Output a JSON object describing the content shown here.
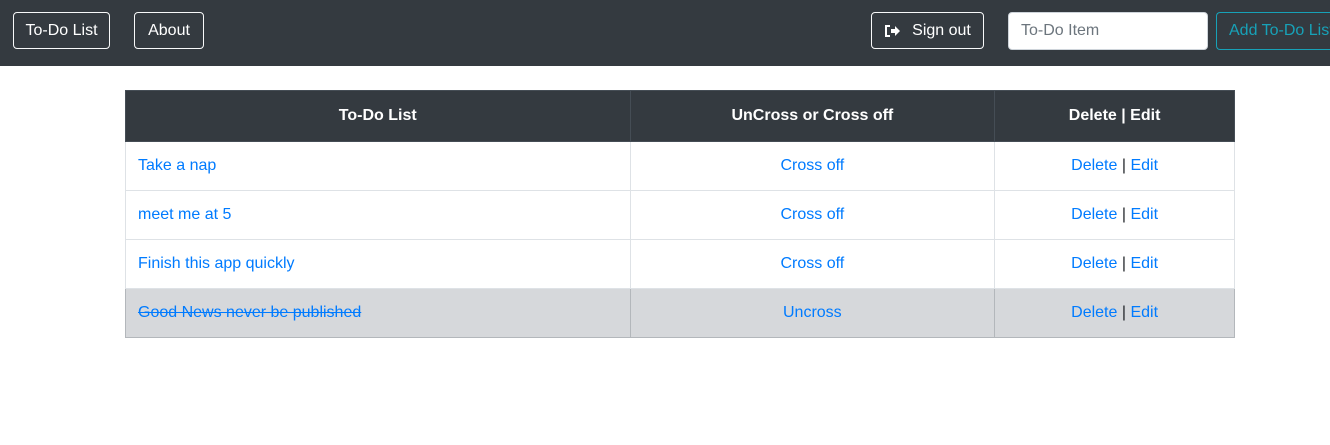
{
  "navbar": {
    "todo_list_label": "To-Do List",
    "about_label": "About",
    "sign_out_label": "Sign out",
    "todo_input_placeholder": "To-Do Item",
    "add_button_label": "Add To-Do List",
    "sign_out_icon": "sign-out-icon"
  },
  "table": {
    "headers": [
      "To-Do List",
      "UnCross or Cross off",
      "Delete | Edit"
    ],
    "delete_label": "Delete",
    "separator": "|",
    "edit_label": "Edit",
    "rows": [
      {
        "item": "Take a nap",
        "toggle": "Cross off",
        "crossed": false
      },
      {
        "item": "meet me at 5",
        "toggle": "Cross off",
        "crossed": false
      },
      {
        "item": "Finish this app quickly",
        "toggle": "Cross off",
        "crossed": false
      },
      {
        "item": "Good News never be published",
        "toggle": "Uncross",
        "crossed": true
      }
    ]
  },
  "colors": {
    "navbar_bg": "#343a40",
    "link": "#007bff",
    "info": "#17a2b8",
    "crossed_row_bg": "#d6d8db"
  }
}
